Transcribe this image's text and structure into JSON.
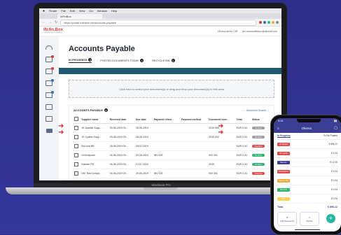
{
  "mac_menu": [
    "Finder",
    "File",
    "Edit",
    "View",
    "Go",
    "Window",
    "Help"
  ],
  "browser": {
    "tab_title": "inFinBox",
    "url": "https://portal.infinbox.be/accounts-payable"
  },
  "app": {
    "logo_main": "IN.fin.Box",
    "logo_sub": "Certified for e-invoicing",
    "user_name": "Olivera demo CAT",
    "user_email": "jan.vanvoutfinbox@olivera.com"
  },
  "page": {
    "title": "Accounts Payable",
    "tabs": [
      {
        "label": "IN PROGRESS",
        "count": "9"
      },
      {
        "label": "POSTED DOCUMENTS TODAY",
        "count": "0"
      },
      {
        "label": "RECYCLE BIN",
        "count": "0"
      }
    ],
    "drop_text": "Click here to select your document(s) or drag and drop your document(s) in this area"
  },
  "table": {
    "title": "ACCOUNTS PAYABLE",
    "count": "9",
    "advanced_search": "Advanced Search",
    "columns": [
      "Supplier name",
      "Received date",
      "Due date",
      "Payment refere...",
      "Payment method",
      "Document num...",
      "Total",
      "Status"
    ],
    "rows": [
      {
        "supplier": "JK Sparkle Supp...",
        "received": "29-06-2019 09:...",
        "due": "28-06-2019",
        "payref": "",
        "method": "",
        "docnum": "2019 069",
        "total": "EUR 0,34",
        "status": "To Post",
        "status_color": "#9aa0a6"
      },
      {
        "supplier": "JK Cynthe Supp...",
        "received": "29-06-2019 09:...",
        "due": "28-06-2019",
        "payref": "",
        "method": "",
        "docnum": "2019 002",
        "total": "EUR 0,34",
        "status": "To Post",
        "status_color": "#9aa0a6"
      },
      {
        "supplier": "Bol.com BE",
        "received": "26-06-2019 09:...",
        "due": "28-02-2019",
        "payref": "",
        "method": "",
        "docnum": "",
        "total": "EUR 0,34",
        "status": "Overdue",
        "status_color": "#e34b4b"
      },
      {
        "supplier": "UniVodpoort",
        "received": "04-06-2019 09:...",
        "due": "20-06-2019",
        "payref": "INV 003",
        "method": "",
        "docnum": "INV 001",
        "total": "EUR 0,34",
        "status": "To Post",
        "status_color": "#2db86f"
      },
      {
        "supplier": "Kaimen PH",
        "received": "04-06-2019 09:...",
        "due": "12-07-2019",
        "payref": "",
        "method": "",
        "docnum": "2019",
        "total": "EUR 0,34",
        "status": "To Post",
        "status_color": "#2db86f"
      },
      {
        "supplier": "DKI Test Compa...",
        "received": "04-06-2019 09:...",
        "due": "29-06-2019",
        "payref": "INV 003",
        "method": "",
        "docnum": "INV 001",
        "total": "EUR 0,34",
        "status": "Overdue",
        "status_color": "#e34b4b"
      }
    ]
  },
  "laptop_brand": "MacBook Pro",
  "phone": {
    "time": "9:41",
    "header_title": "Olivera",
    "tabs": [
      "In Progress",
      "To Be Posted"
    ],
    "rows": [
      {
        "chip": "JK Sparkle",
        "chip_color": "#e34b4b",
        "amount": "€ 896,12"
      },
      {
        "chip": "JK Cynthe",
        "chip_color": "#e34b4b",
        "amount": "€ 0,34"
      },
      {
        "chip": "Bol.com",
        "chip_color": "#3b3f94",
        "amount": "€ 12,00"
      },
      {
        "chip": "UniVodpoort",
        "chip_color": "#e34b4b",
        "amount": "€ 0,34"
      },
      {
        "chip": "Kaimen PH",
        "chip_color": "#f0a93a",
        "amount": "€ 0,34"
      },
      {
        "chip": "DKI Test",
        "chip_color": "#2db86f",
        "amount": "€ 0,34"
      },
      {
        "chip": "Other",
        "chip_color": "#f7d154",
        "amount": "€ 0,34"
      }
    ],
    "total_label": "Total",
    "total_value": "€ 896,12",
    "actions": [
      "Add Documents",
      "Archive"
    ]
  },
  "colors": {
    "background": "#2d2e88",
    "accent_band": "#1e5a73",
    "brand_red": "#e23b3b",
    "phone_header": "#3b3f94",
    "phone_fab": "#26b8a3"
  }
}
